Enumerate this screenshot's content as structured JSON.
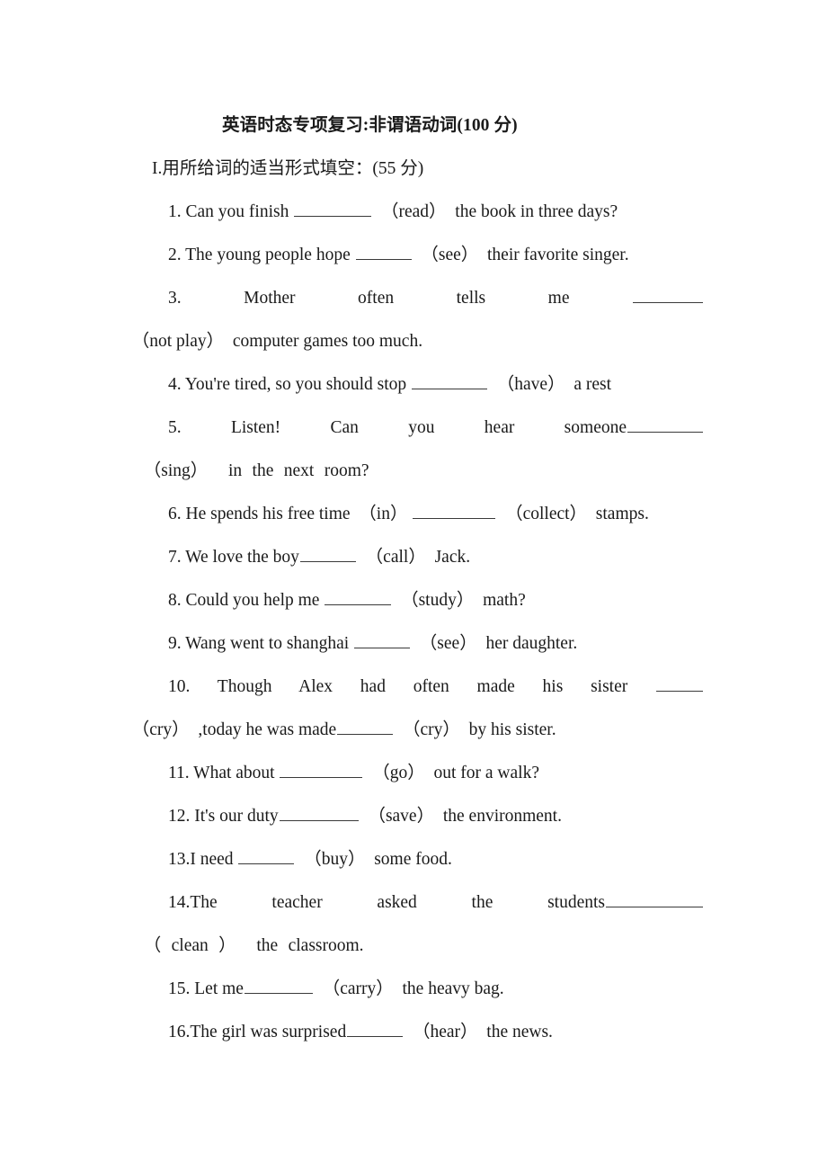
{
  "document": {
    "title": "英语时态专项复习:非谓语动词(100 分)",
    "section_heading": "I.用所给词的适当形式填空：(55 分)",
    "exercises": [
      {
        "number": "1.",
        "pre": " Can you finish ",
        "cue": "（read）",
        "post": "  the book in three days?",
        "blank_width": 86
      },
      {
        "number": "2.",
        "pre": " The young people hope ",
        "cue": "（see）",
        "post": "  their favorite singer.",
        "blank_width": 62
      },
      {
        "number": "3.",
        "pre": " Mother often tells me ",
        "cue": "（not play）",
        "post": "  computer games too much.",
        "blank_width": 78
      },
      {
        "number": "4.",
        "pre": " You're tired, so you should stop ",
        "cue": "（have）",
        "post": "  a rest",
        "blank_width": 84
      },
      {
        "number": "5.",
        "pre": " Listen! Can you hear someone",
        "cue": "（sing）",
        "post": "  in the next room?",
        "blank_width": 84
      },
      {
        "number": "6.",
        "pre": " He spends his free time  （in） ",
        "cue": "（collect）",
        "post": "  stamps.",
        "blank_width": 92
      },
      {
        "number": "7.",
        "pre": " We love the boy",
        "cue": "（call）",
        "post": "  Jack.",
        "blank_width": 62
      },
      {
        "number": "8.",
        "pre": " Could you help me ",
        "cue": "（study）",
        "post": "  math?",
        "blank_width": 74
      },
      {
        "number": "9.",
        "pre": " Wang went to shanghai ",
        "cue": "（see）",
        "post": "  her daughter.",
        "blank_width": 62
      },
      {
        "number": "10.",
        "pre": " Though Alex had often made his sister ",
        "cue": "（cry）",
        "post": "  ,today he was made",
        "blank_width": 52,
        "cue2": "（cry）",
        "post2": "  by his sister.",
        "blank2_width": 62
      },
      {
        "number": "11.",
        "pre": " What about ",
        "cue": "（go）",
        "post": "  out for a walk?",
        "blank_width": 92
      },
      {
        "number": "12.",
        "pre": " It's our duty",
        "cue": "（save）",
        "post": "  the environment.",
        "blank_width": 88
      },
      {
        "number": "13.",
        "pre": "I need ",
        "cue": "（buy）",
        "post": "  some food.",
        "blank_width": 62
      },
      {
        "number": "14.",
        "pre": "The teacher asked the students",
        "cue": "（ clean ）",
        "post": "  the classroom.",
        "blank_width": 108
      },
      {
        "number": "15.",
        "pre": " Let me",
        "cue": "（carry）",
        "post": "  the heavy bag.",
        "blank_width": 76
      },
      {
        "number": "16.",
        "pre": "The girl was surprised",
        "cue": "（hear）",
        "post": "  the news.",
        "blank_width": 62
      }
    ]
  },
  "colors": {
    "page_background": "#ffffff",
    "text": "#1a1a1a",
    "rule": "#3a3a3a"
  }
}
